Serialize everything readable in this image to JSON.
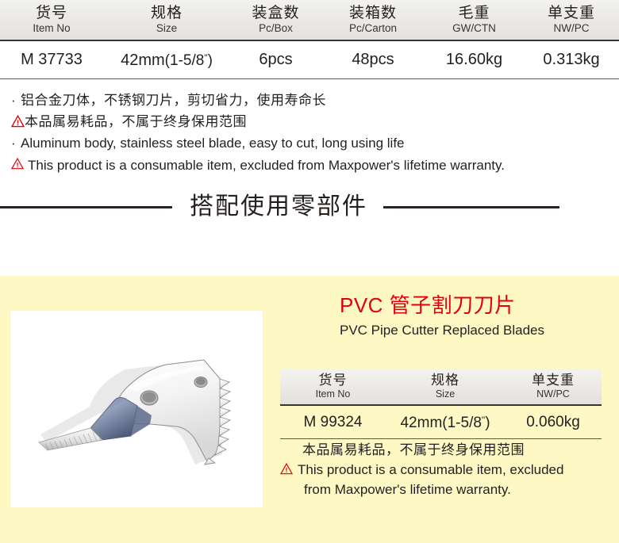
{
  "main_table": {
    "columns": [
      {
        "cn": "货号",
        "en": "Item No"
      },
      {
        "cn": "规格",
        "en": "Size"
      },
      {
        "cn": "装盒数",
        "en": "Pc/Box"
      },
      {
        "cn": "装箱数",
        "en": "Pc/Carton"
      },
      {
        "cn": "毛重",
        "en": "GW/CTN"
      },
      {
        "cn": "单支重",
        "en": "NW/PC"
      }
    ],
    "row": {
      "item_no": "M 37733",
      "size_metric": "42mm",
      "size_imperial": "(1-5/8",
      "size_inch_mark": "\"",
      "size_imperial_close": ")",
      "pc_box": "6pcs",
      "pc_carton": "48pcs",
      "gw_ctn": "16.60kg",
      "nw_pc": "0.313kg"
    }
  },
  "features": {
    "bullet_mark": "·",
    "line_cn": "铝合金刀体，不锈钢刀片，剪切省力，使用寿命长",
    "warn_cn": "本品属易耗品，不属于终身保用范围",
    "line_en": "Aluminum body, stainless steel blade, easy to cut, long using life",
    "warn_en": "This product is a consumable item, excluded from Maxpower's lifetime warranty."
  },
  "section": {
    "title": "搭配使用零部件"
  },
  "panel": {
    "title_cn": "PVC 管子割刀刀片",
    "title_en": "PVC Pipe Cutter Replaced Blades",
    "table": {
      "columns": [
        {
          "cn": "货号",
          "en": "Item No"
        },
        {
          "cn": "规格",
          "en": "Size"
        },
        {
          "cn": "单支重",
          "en": "NW/PC"
        }
      ],
      "row": {
        "item_no": "M 99324",
        "size_metric": "42mm",
        "size_imperial": "(1-5/8",
        "size_inch_mark": "\"",
        "size_imperial_close": ")",
        "nw_pc": "0.060kg"
      }
    },
    "warn_cn": "本品属易耗品，不属于终身保用范围",
    "warn_en_line1": "This product is a consumable item, excluded",
    "warn_en_line2": "from Maxpower's lifetime warranty."
  },
  "colors": {
    "panel_bg": "#fdf8c4",
    "title_red": "#e3000f",
    "warning_red": "#e3000f",
    "rule_dark": "#2b2320",
    "text": "#231f20"
  }
}
